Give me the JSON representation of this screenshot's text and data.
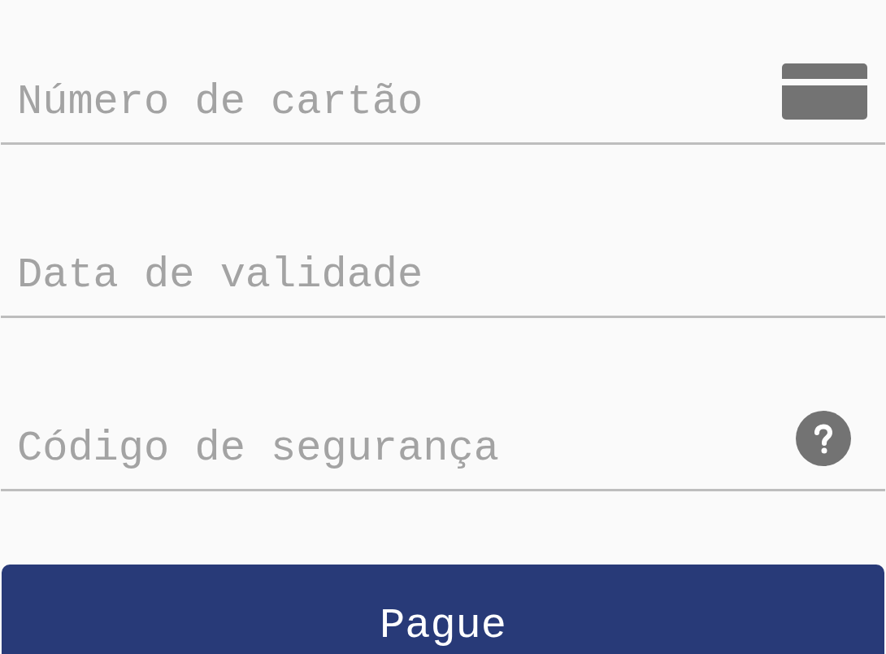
{
  "fields": [
    {
      "kind": "card",
      "placeholder": "Número de cartão"
    },
    {
      "kind": "date",
      "placeholder": "Data de validade"
    },
    {
      "kind": "security",
      "placeholder": "Código de segurança"
    }
  ],
  "button": {
    "label": "Pague"
  }
}
